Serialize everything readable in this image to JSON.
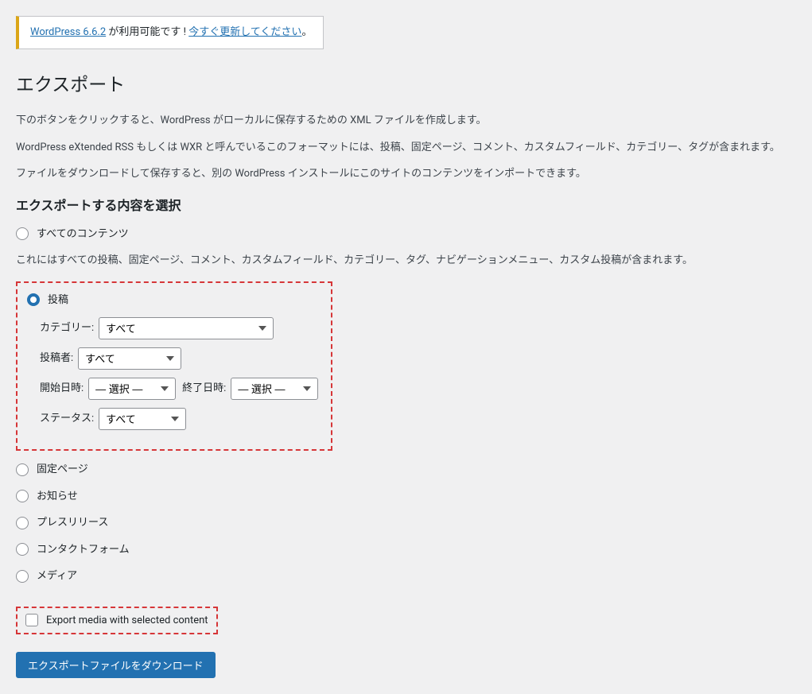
{
  "notice": {
    "link1": "WordPress 6.6.2",
    "text1": " が利用可能です ! ",
    "link2": "今すぐ更新してください",
    "text2": "。"
  },
  "page_title": "エクスポート",
  "intro": {
    "p1": "下のボタンをクリックすると、WordPress がローカルに保存するための XML ファイルを作成します。",
    "p2": "WordPress eXtended RSS もしくは WXR と呼んでいるこのフォーマットには、投稿、固定ページ、コメント、カスタムフィールド、カテゴリー、タグが含まれます。",
    "p3": "ファイルをダウンロードして保存すると、別の WordPress インストールにこのサイトのコンテンツをインポートできます。"
  },
  "section_title": "エクスポートする内容を選択",
  "options": {
    "all": "すべてのコンテンツ",
    "all_desc": "これにはすべての投稿、固定ページ、コメント、カスタムフィールド、カテゴリー、タグ、ナビゲーションメニュー、カスタム投稿が含まれます。",
    "posts": "投稿",
    "pages": "固定ページ",
    "news": "お知らせ",
    "press": "プレスリリース",
    "contact": "コンタクトフォーム",
    "media": "メディア"
  },
  "posts_fields": {
    "category_label": "カテゴリー:",
    "category_value": "すべて",
    "author_label": "投稿者:",
    "author_value": "すべて",
    "startdate_label": "開始日時:",
    "startdate_value": "— 選択 —",
    "enddate_label": "終了日時:",
    "enddate_value": "— 選択 —",
    "status_label": "ステータス:",
    "status_value": "すべて"
  },
  "export_media_checkbox": "Export media with selected content",
  "download_button": "エクスポートファイルをダウンロード"
}
